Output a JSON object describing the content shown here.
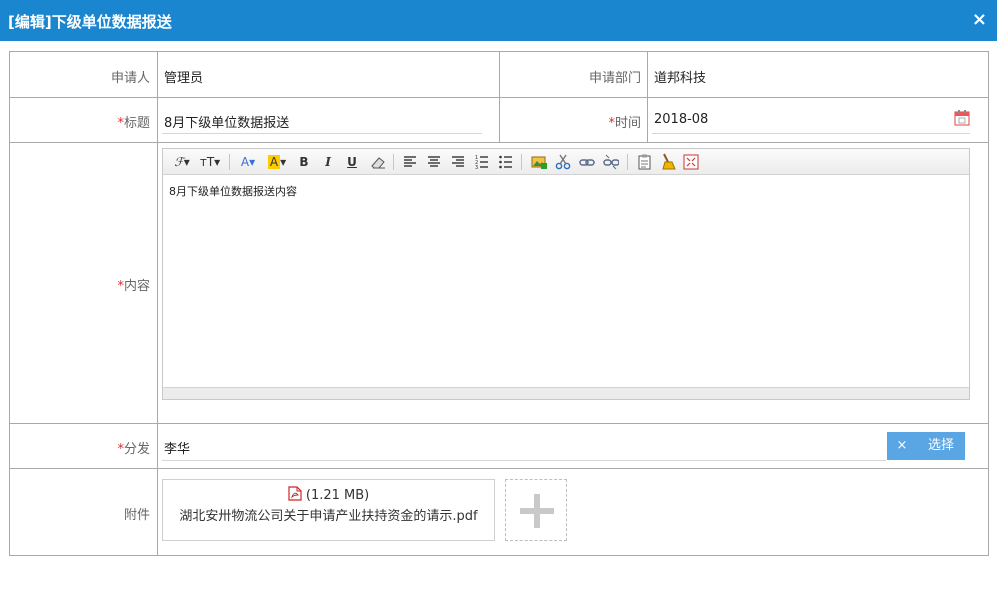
{
  "dialog": {
    "title": "[编辑]下级单位数据报送",
    "close_glyph": "×"
  },
  "form": {
    "applicant_label": "申请人",
    "applicant_value": "管理员",
    "department_label": "申请部门",
    "department_value": "道邦科技",
    "required_mark": "*",
    "subject_label": "标题",
    "subject_value": "8月下级单位数据报送",
    "time_label": "时间",
    "time_value": "2018-08",
    "content_label": "内容",
    "content_value": "8月下级单位数据报送内容",
    "distribute_label": "分发",
    "distribute_value": "李华",
    "clear_button": "×",
    "select_button": "选择",
    "attachment_label": "附件",
    "attachment_size": "(1.21 MB)",
    "attachment_name": "湖北安卅物流公司关于申请产业扶持资金的请示.pdf"
  },
  "toolbar_icons": [
    "font-family-icon",
    "font-size-icon",
    "font-color-icon",
    "highlight-color-icon",
    "bold-icon",
    "italic-icon",
    "underline-icon",
    "eraser-icon",
    "align-left-icon",
    "align-center-icon",
    "align-right-icon",
    "ordered-list-icon",
    "unordered-list-icon",
    "image-icon",
    "cut-icon",
    "link-icon",
    "unlink-icon",
    "paste-icon",
    "clean-icon",
    "fullscreen-icon"
  ],
  "colors": {
    "titlebar": "#1a86d0",
    "button": "#5aa6e4",
    "required": "#e03030"
  }
}
